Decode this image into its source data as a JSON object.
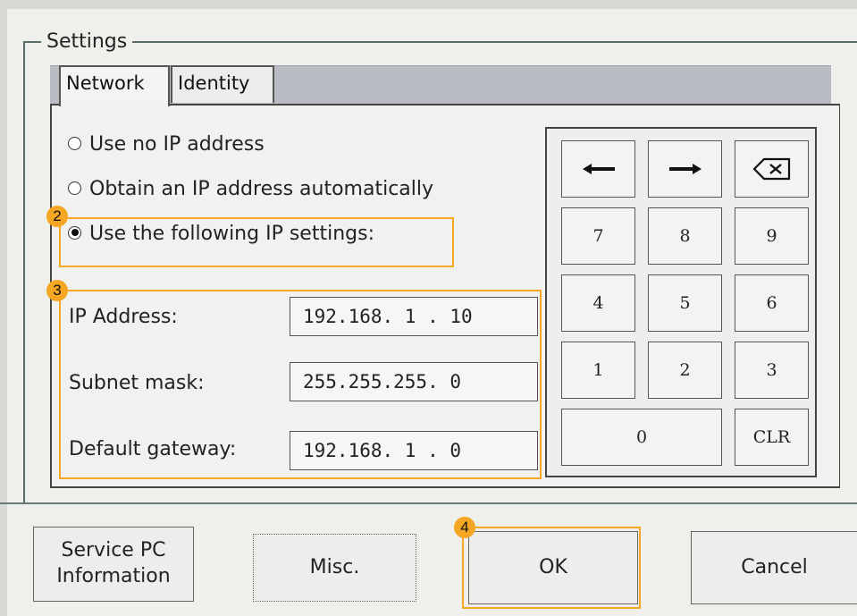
{
  "settings": {
    "title": "Settings",
    "tabs": [
      {
        "label": "Network",
        "active": true
      },
      {
        "label": "Identity",
        "active": false
      }
    ],
    "radios": [
      {
        "label": "Use no IP address",
        "checked": false
      },
      {
        "label": "Obtain an IP address automatically",
        "checked": false
      },
      {
        "label": "Use the following IP settings:",
        "checked": true
      }
    ],
    "fields": [
      {
        "label": "IP Address:",
        "value": "192.168. 1 . 10"
      },
      {
        "label": "Subnet mask:",
        "value": "255.255.255. 0"
      },
      {
        "label": "Default gateway:",
        "value": "192.168. 1 . 0"
      }
    ]
  },
  "keypad": {
    "keys": [
      "7",
      "8",
      "9",
      "4",
      "5",
      "6",
      "1",
      "2",
      "3",
      "0",
      "CLR"
    ],
    "arrow_left": "left-arrow-icon",
    "arrow_right": "right-arrow-icon",
    "backspace": "backspace-icon"
  },
  "annotations": [
    "2",
    "3",
    "4"
  ],
  "buttons": {
    "service_line1": "Service PC",
    "service_line2": "Information",
    "misc": "Misc.",
    "ok": "OK",
    "cancel": "Cancel"
  },
  "colors": {
    "highlight": "#f5a623",
    "tab_strip": "#b9bcc2",
    "background": "#efefec"
  }
}
